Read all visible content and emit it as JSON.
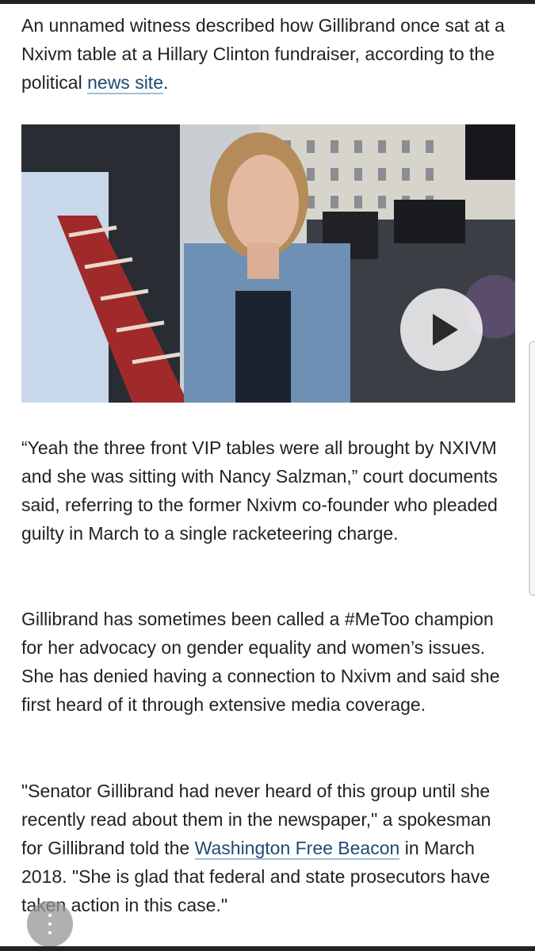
{
  "article": {
    "paragraph1": {
      "text": "An unnamed witness described how Gillibrand once sat at a Nxivm table at a Hillary Clinton fundraiser, according to the political ",
      "link": "news site",
      "end": "."
    },
    "media": {
      "image_description_icon": "news-photo",
      "play_icon": "play-icon"
    },
    "paragraph2": "“Yeah the three front VIP tables were all brought by NXIVM and she was sitting with Nancy Salzman,” court documents said, referring to the former Nxivm co-founder who pleaded guilty in March to a single racketeering charge.",
    "paragraph3": "Gillibrand has sometimes been called a #MeToo champion for her advocacy on gender equality and women’s issues. She has denied having a connection to Nxivm and said she first heard of it through extensive media coverage.",
    "paragraph4": {
      "text": "\"Senator Gillibrand had never heard of this group until she recently read about them in the newspaper,\" a spokesman for Gillibrand told the ",
      "link": "Washington Free Beacon",
      "end": " in March 2018. \"She is glad that federal and state prosecutors have taken action in this case.\""
    }
  },
  "ui": {
    "fab_icon": "more-vertical-icon",
    "colors": {
      "text": "#222222",
      "link": "#1e4a73",
      "link_underline": "#9fc0dd"
    }
  }
}
